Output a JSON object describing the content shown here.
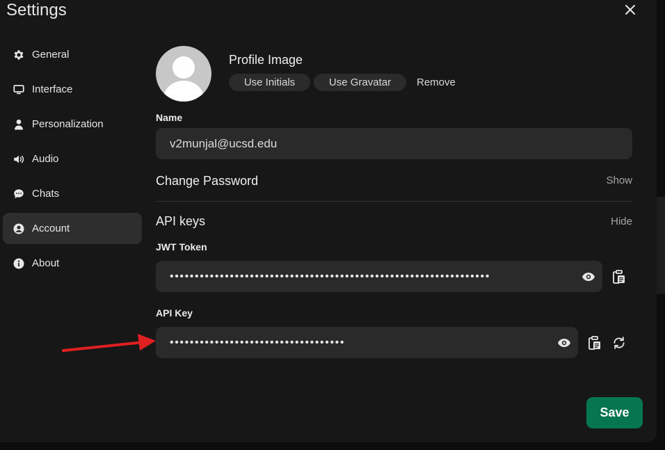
{
  "header": {
    "title": "Settings",
    "close_icon": "close-icon"
  },
  "sidebar": {
    "items": [
      {
        "label": "General",
        "icon": "gear-icon",
        "active": false
      },
      {
        "label": "Interface",
        "icon": "monitor-icon",
        "active": false
      },
      {
        "label": "Personalization",
        "icon": "user-icon",
        "active": false
      },
      {
        "label": "Audio",
        "icon": "speaker-icon",
        "active": false
      },
      {
        "label": "Chats",
        "icon": "chat-bubble-icon",
        "active": false
      },
      {
        "label": "Account",
        "icon": "user-circle-icon",
        "active": true
      },
      {
        "label": "About",
        "icon": "info-icon",
        "active": false
      }
    ]
  },
  "profile": {
    "image_label": "Profile Image",
    "use_initials_label": "Use Initials",
    "use_gravatar_label": "Use Gravatar",
    "remove_label": "Remove"
  },
  "name": {
    "label": "Name",
    "value": "v2munjal@ucsd.edu"
  },
  "password": {
    "label": "Change Password",
    "toggle_label": "Show"
  },
  "api_keys": {
    "label": "API keys",
    "toggle_label": "Hide",
    "jwt": {
      "label": "JWT Token",
      "masked_value": "••••••••••••••••••••••••••••••••••••••••••••••••••••••••••••••••"
    },
    "api_key": {
      "label": "API Key",
      "masked_value": "•••••••••••••••••••••••••••••••••••"
    }
  },
  "footer": {
    "save_label": "Save",
    "save_color": "#05764f"
  },
  "annotation": {
    "arrow_color": "#e02020"
  }
}
